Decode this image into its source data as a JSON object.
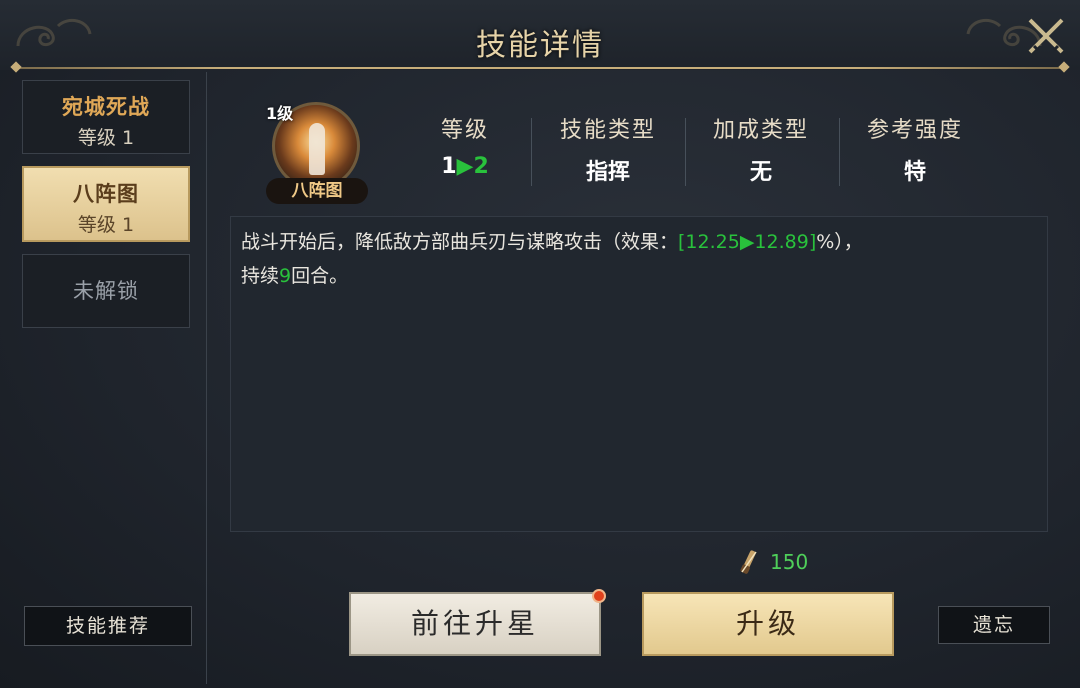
{
  "window": {
    "title": "技能详情",
    "close_icon": "crossed-swords-close-icon"
  },
  "sidebar": {
    "tabs": [
      {
        "name": "宛城死战",
        "level": "等级 1",
        "state": "normal"
      },
      {
        "name": "八阵图",
        "level": "等级 1",
        "state": "selected"
      },
      {
        "name": "未解锁",
        "level": "",
        "state": "locked"
      }
    ],
    "recommend_label": "技能推荐"
  },
  "skill": {
    "level_badge": "1级",
    "name": "八阵图",
    "stats": [
      {
        "label": "等级",
        "from": "1",
        "arrow": "▶",
        "to": "2"
      },
      {
        "label": "技能类型",
        "value": "指挥"
      },
      {
        "label": "加成类型",
        "value": "无"
      },
      {
        "label": "参考强度",
        "value": "特"
      }
    ],
    "description": {
      "part1": "战斗开始后，降低敌方部曲兵刃与谋略攻击（效果：",
      "effect": "[12.25▶12.89]",
      "part2": "%），",
      "part3": "持续",
      "turns": "9",
      "part4": "回合。"
    }
  },
  "cost": {
    "icon": "scroll-brush-icon",
    "amount": "150"
  },
  "actions": {
    "star_label": "前往升星",
    "upgrade_label": "升级",
    "forget_label": "遗忘"
  },
  "colors": {
    "accent_gold": "#e0a857",
    "green": "#29c23c",
    "notify_red": "#e0421d"
  }
}
